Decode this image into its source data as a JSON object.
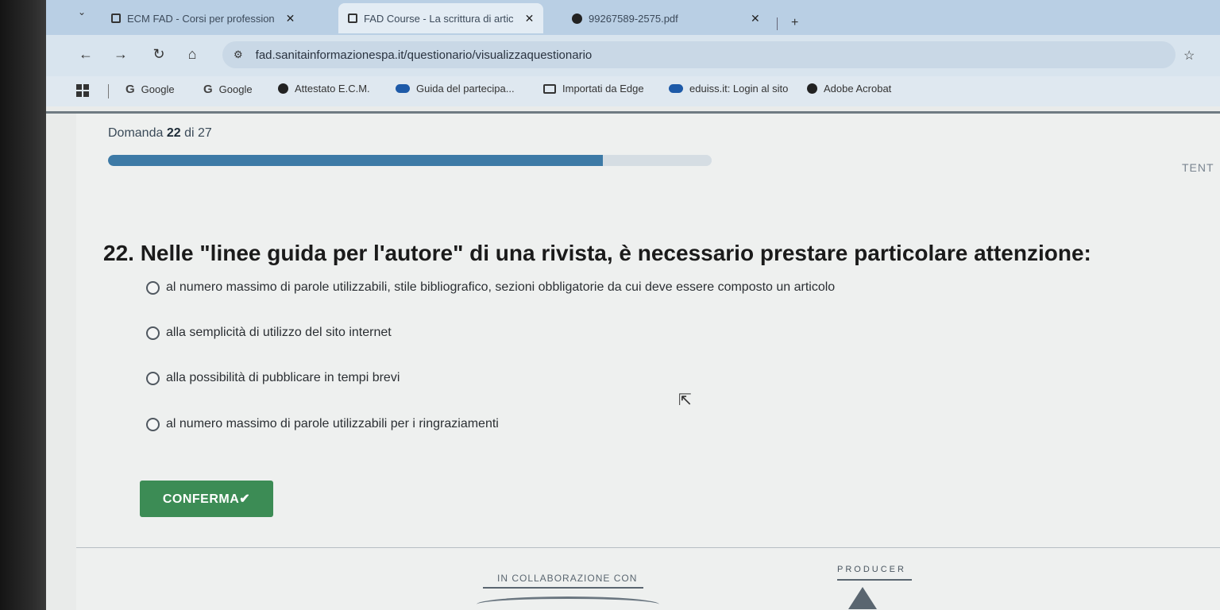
{
  "browser": {
    "tabs": [
      {
        "title": "ECM FAD - Corsi per profession",
        "active": false
      },
      {
        "title": "FAD Course - La scrittura di artic",
        "active": true
      },
      {
        "title": "99267589-2575.pdf",
        "active": false
      }
    ],
    "new_tab_label": "+",
    "url": "fad.sanitainformazionespa.it/questionario/visualizzaquestionario",
    "bookmarks": [
      {
        "label": "Google",
        "icon": "google-icon"
      },
      {
        "label": "Google",
        "icon": "google-icon"
      },
      {
        "label": "Attestato E.C.M.",
        "icon": "globe-icon"
      },
      {
        "label": "Guida del partecipa...",
        "icon": "cloud-icon"
      },
      {
        "label": "Importati da Edge",
        "icon": "folder-icon"
      },
      {
        "label": "eduiss.it: Login al sito",
        "icon": "cloud-icon"
      },
      {
        "label": "Adobe Acrobat",
        "icon": "globe-icon"
      }
    ]
  },
  "quiz": {
    "counter_prefix": "Domanda",
    "current": "22",
    "counter_mid": "di",
    "total": "27",
    "progress": 0.82,
    "side_label": "TENT",
    "question": "22. Nelle \"linee guida per l'autore\" di una rivista, è necessario prestare particolare attenzione:",
    "options": [
      "al numero massimo di parole utilizzabili, stile bibliografico, sezioni obbligatorie da cui deve essere composto un articolo",
      "alla semplicità di utilizzo del sito internet",
      "alla possibilità di pubblicare in tempi brevi",
      "al numero massimo di parole utilizzabili per i ringraziamenti"
    ],
    "confirm_label": "CONFERMA✔"
  },
  "footer": {
    "collab_label": "IN COLLABORAZIONE CON",
    "producer_label": "PRODUCER"
  },
  "colors": {
    "progress_fill": "#3d7aa6",
    "confirm_bg": "#3c8c55"
  }
}
